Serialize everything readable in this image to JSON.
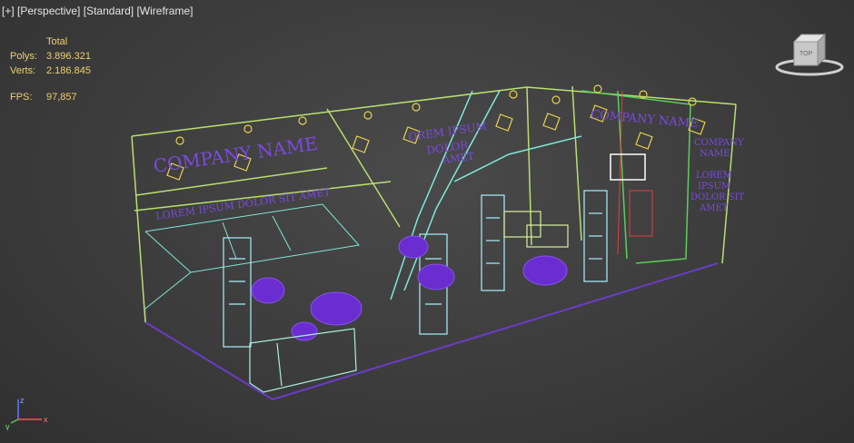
{
  "viewport": {
    "labels": [
      "[+]",
      "[Perspective]",
      "[Standard]",
      "[Wireframe]"
    ]
  },
  "stats": {
    "header": "Total",
    "polys_label": "Polys:",
    "polys_value": "3.896.321",
    "verts_label": "Verts:",
    "verts_value": "2.186.845",
    "fps_label": "FPS:",
    "fps_value": "97,857"
  },
  "scene_text": {
    "company_left": "COMPANY NAME",
    "lorem_left": "LOREM IPSUM DOLOR SIT AMET",
    "lorem_mid_1": "OREM IPSUM",
    "lorem_mid_2": "DOLOR",
    "lorem_mid_3": "AMET",
    "company_right": "COMPANY NAME",
    "side_company_1": "COMPANY",
    "side_company_2": "NAME",
    "side_lorem_1": "LOREM",
    "side_lorem_2": "IPSUM",
    "side_lorem_3": "DOLOR SIT",
    "side_lorem_4": "AMET"
  },
  "viewcube": {
    "face_label": "TOP"
  },
  "axis": {
    "x": "x",
    "y": "y",
    "z": "z"
  },
  "colors": {
    "background": "#3c3c3c",
    "stats_text": "#f0d070",
    "wire_green": "#9be36a",
    "wire_yellow": "#e8e87a",
    "wire_cyan": "#7ee8d8",
    "wire_purple": "#6a3cc8",
    "text_purple": "#7a4ae0",
    "wire_red": "#e04040"
  }
}
